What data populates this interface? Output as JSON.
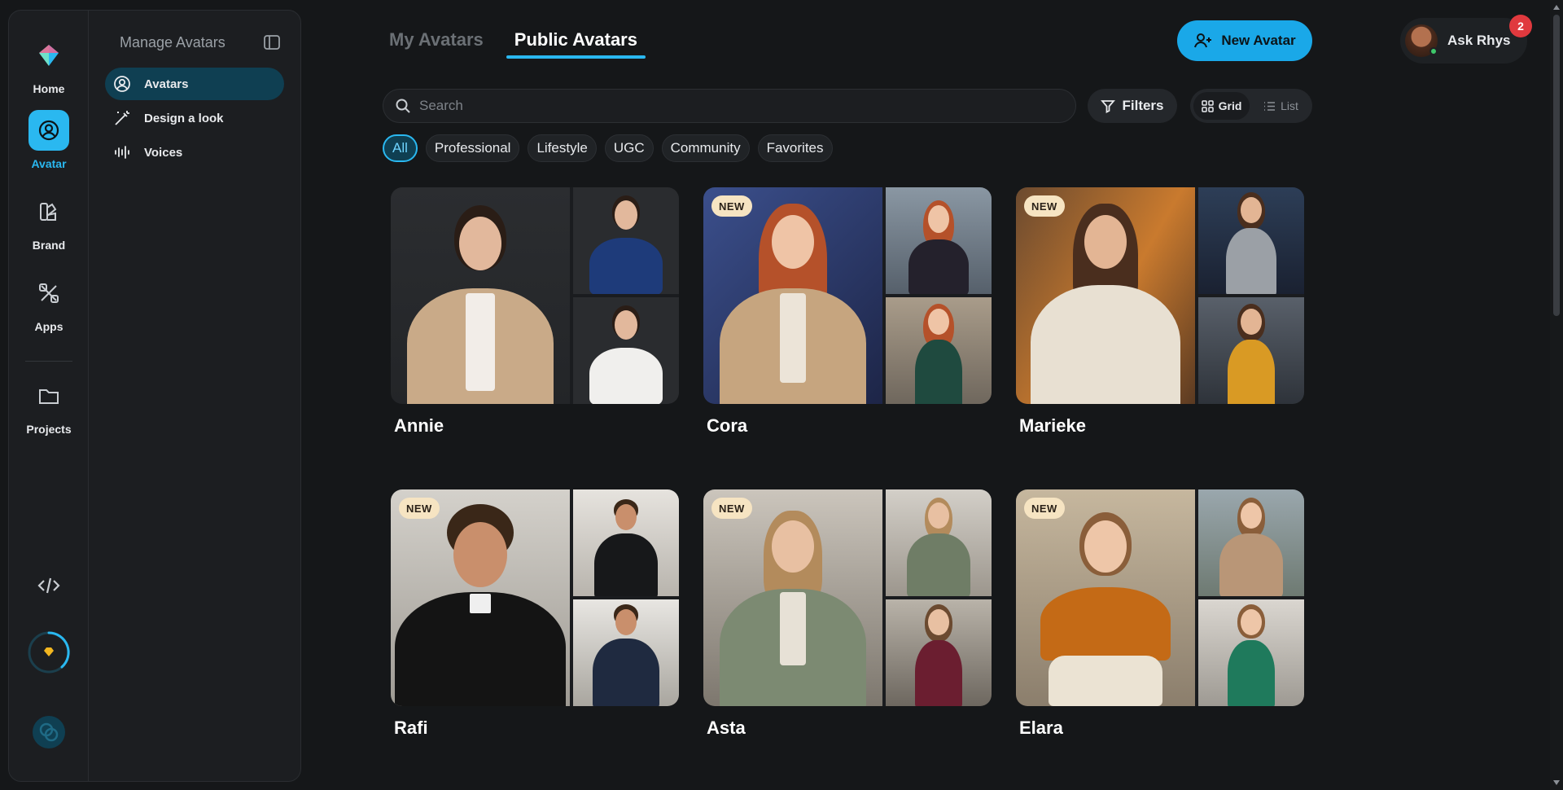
{
  "rail": {
    "items": [
      {
        "label": "Home",
        "icon": "logo-icon"
      },
      {
        "label": "Avatar",
        "icon": "avatar-icon",
        "active": true
      },
      {
        "label": "Brand",
        "icon": "brand-icon"
      },
      {
        "label": "Apps",
        "icon": "apps-icon"
      },
      {
        "label": "Projects",
        "icon": "folder-icon"
      }
    ]
  },
  "submenu": {
    "title": "Manage Avatars",
    "items": [
      {
        "label": "Avatars",
        "active": true
      },
      {
        "label": "Design a look"
      },
      {
        "label": "Voices"
      }
    ]
  },
  "tabs": [
    {
      "label": "My Avatars"
    },
    {
      "label": "Public Avatars",
      "active": true
    }
  ],
  "new_avatar": {
    "label": "New Avatar"
  },
  "user": {
    "name": "Ask Rhys",
    "notifications": "2"
  },
  "search": {
    "placeholder": "Search"
  },
  "filters": {
    "label": "Filters"
  },
  "view": {
    "grid": "Grid",
    "list": "List",
    "selected": "Grid"
  },
  "chips": [
    {
      "label": "All",
      "active": true
    },
    {
      "label": "Professional"
    },
    {
      "label": "Lifestyle"
    },
    {
      "label": "UGC"
    },
    {
      "label": "Community"
    },
    {
      "label": "Favorites"
    }
  ],
  "avatars": [
    {
      "name": "Annie",
      "badge": ""
    },
    {
      "name": "Cora",
      "badge": "NEW"
    },
    {
      "name": "Marieke",
      "badge": "NEW"
    },
    {
      "name": "Rafi",
      "badge": "NEW"
    },
    {
      "name": "Asta",
      "badge": "NEW"
    },
    {
      "name": "Elara",
      "badge": "NEW"
    }
  ],
  "colors": {
    "accent": "#2ab8f0",
    "badge_bg": "#f6e4c2",
    "notification": "#e0393e"
  }
}
